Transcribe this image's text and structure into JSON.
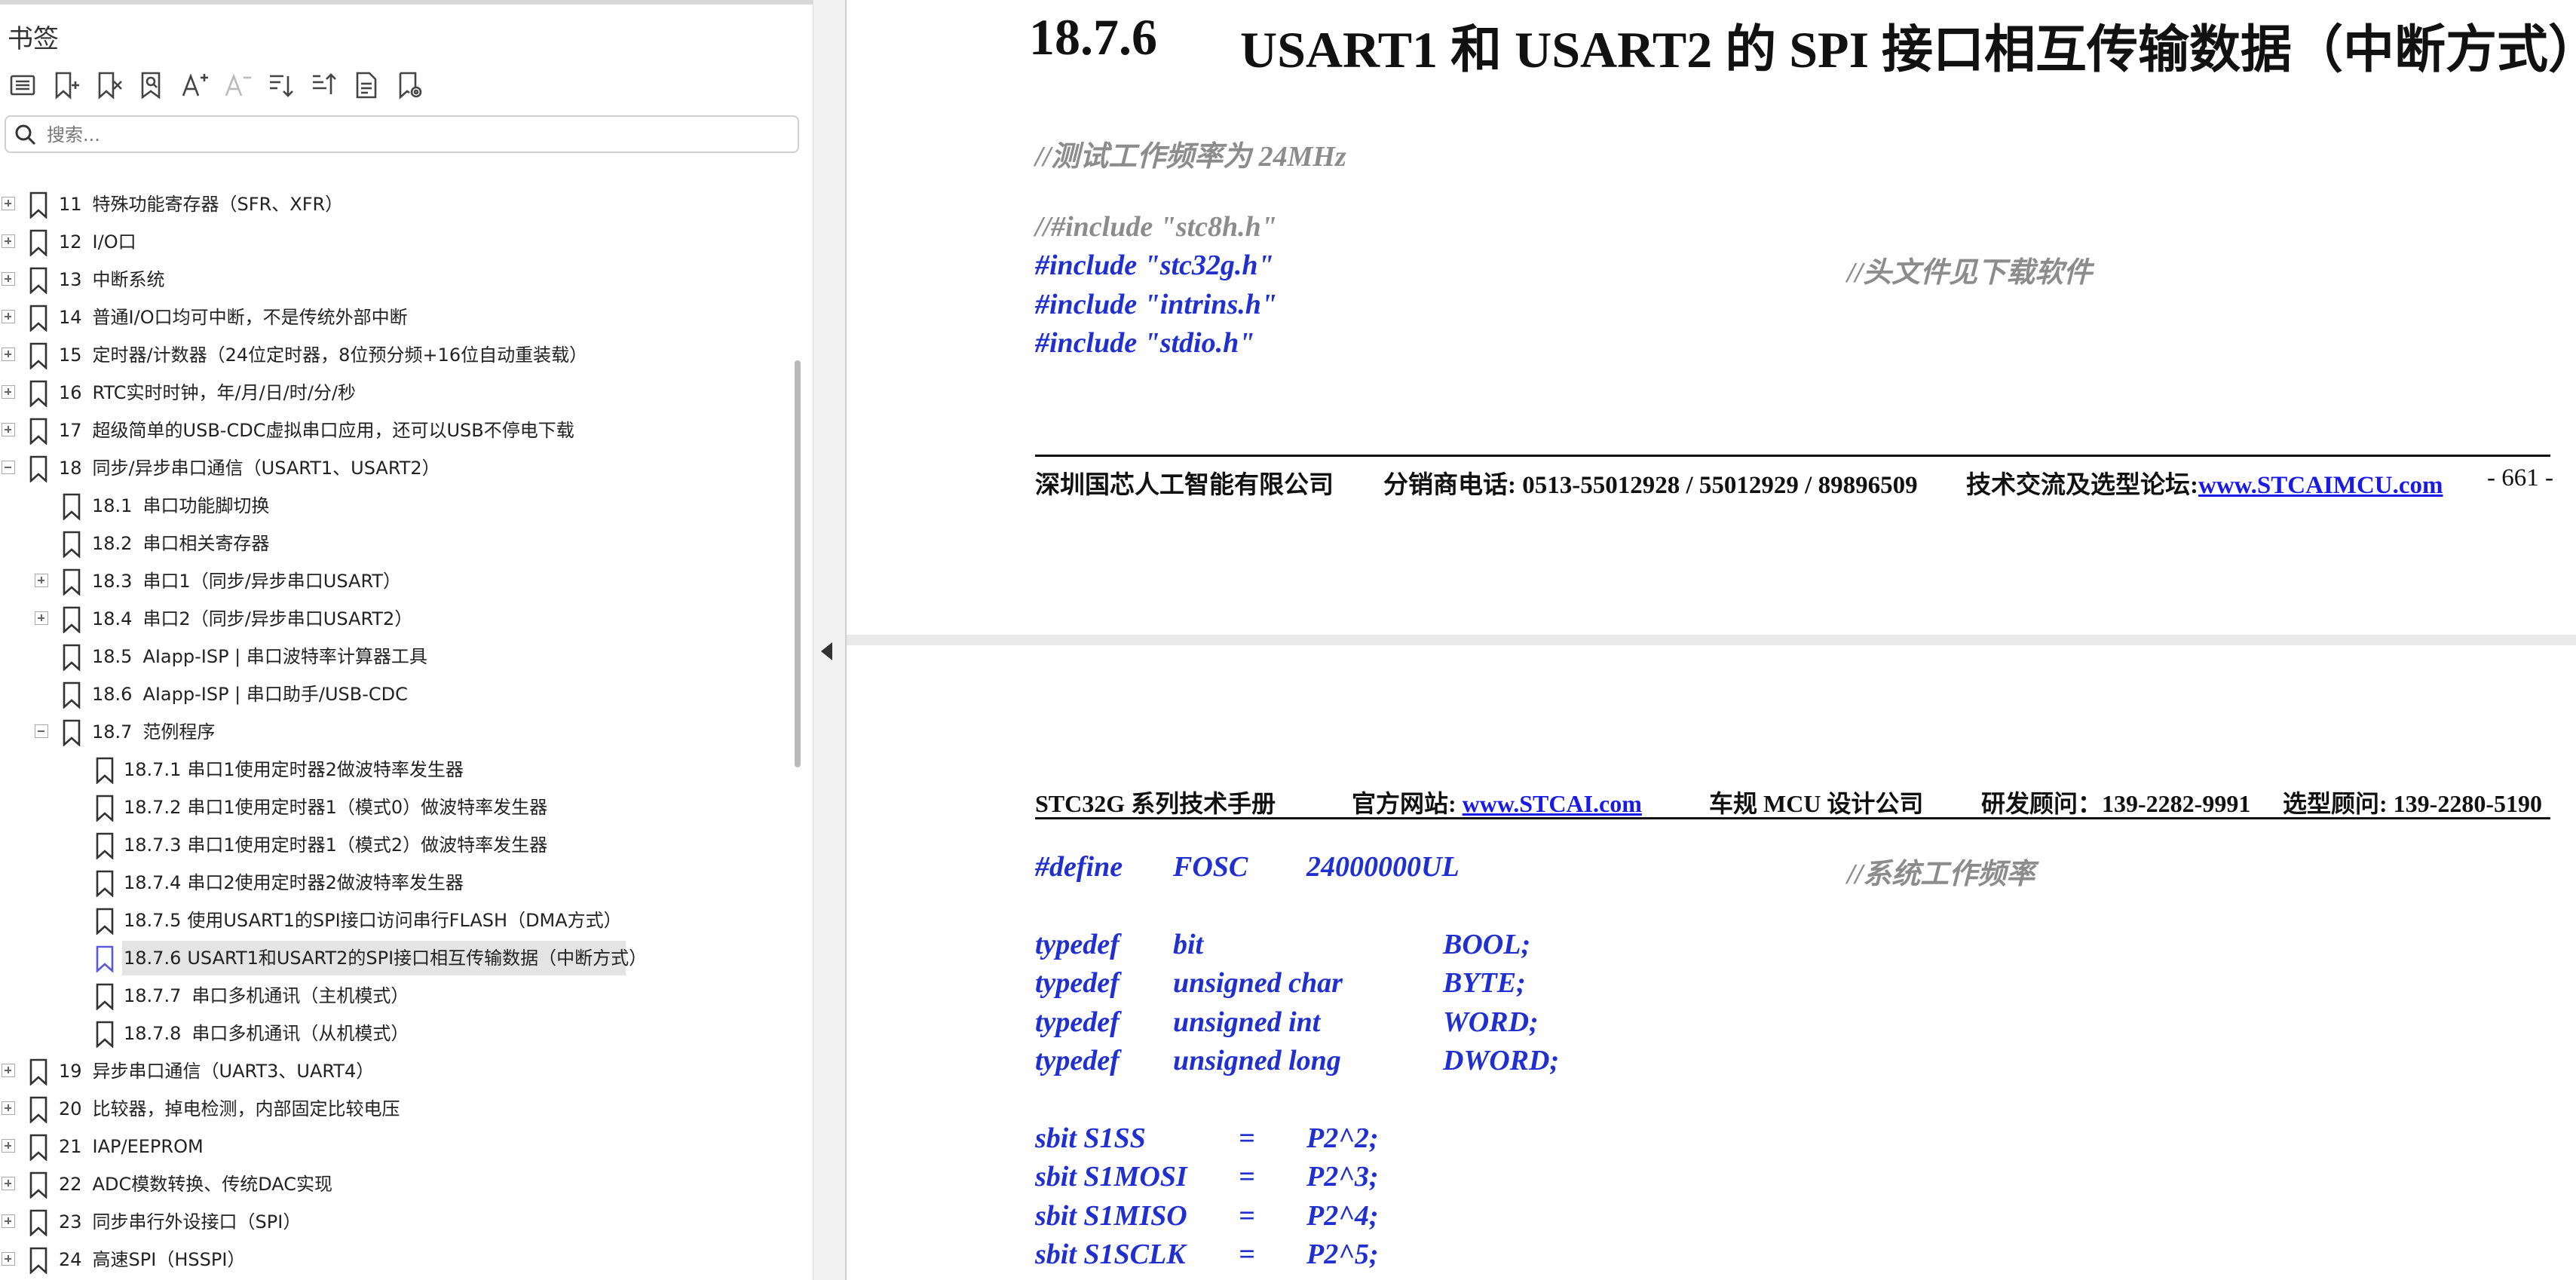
{
  "panel": {
    "title": "书签",
    "search_placeholder": "搜索..."
  },
  "toolbar_icons": [
    "list-icon",
    "add-bookmark-icon",
    "delete-bookmark-icon",
    "find-bookmark-icon",
    "font-increase-icon",
    "font-decrease-icon",
    "expand-all-icon",
    "collapse-all-icon",
    "current-bookmark-icon",
    "bookmark-settings-icon"
  ],
  "bookmarks": [
    {
      "level": 0,
      "exp": "plus",
      "num": "11",
      "text": "特殊功能寄存器（SFR、XFR）"
    },
    {
      "level": 0,
      "exp": "plus",
      "num": "12",
      "text": "I/O口"
    },
    {
      "level": 0,
      "exp": "plus",
      "num": "13",
      "text": "中断系统"
    },
    {
      "level": 0,
      "exp": "plus",
      "num": "14",
      "text": "普通I/O口均可中断，不是传统外部中断"
    },
    {
      "level": 0,
      "exp": "plus",
      "num": "15",
      "text": "定时器/计数器（24位定时器，8位预分频+16位自动重装载）"
    },
    {
      "level": 0,
      "exp": "plus",
      "num": "16",
      "text": "RTC实时时钟，年/月/日/时/分/秒"
    },
    {
      "level": 0,
      "exp": "plus",
      "num": "17",
      "text": "超级简单的USB-CDC虚拟串口应用，还可以USB不停电下载"
    },
    {
      "level": 0,
      "exp": "minus",
      "num": "18",
      "text": "同步/异步串口通信（USART1、USART2）"
    },
    {
      "level": 1,
      "exp": "",
      "num": "18.1",
      "text": "串口功能脚切换"
    },
    {
      "level": 1,
      "exp": "",
      "num": "18.2",
      "text": "串口相关寄存器"
    },
    {
      "level": 1,
      "exp": "plus",
      "num": "18.3",
      "text": "串口1（同步/异步串口USART）"
    },
    {
      "level": 1,
      "exp": "plus",
      "num": "18.4",
      "text": "串口2（同步/异步串口USART2）"
    },
    {
      "level": 1,
      "exp": "",
      "num": "18.5",
      "text": "AIapp-ISP | 串口波特率计算器工具"
    },
    {
      "level": 1,
      "exp": "",
      "num": "18.6",
      "text": "AIapp-ISP | 串口助手/USB-CDC"
    },
    {
      "level": 1,
      "exp": "minus",
      "num": "18.7",
      "text": "范例程序"
    },
    {
      "level": 2,
      "exp": "",
      "num": "18.7.1",
      "text": "串口1使用定时器2做波特率发生器"
    },
    {
      "level": 2,
      "exp": "",
      "num": "18.7.2",
      "text": "串口1使用定时器1（模式0）做波特率发生器"
    },
    {
      "level": 2,
      "exp": "",
      "num": "18.7.3",
      "text": "串口1使用定时器1（模式2）做波特率发生器"
    },
    {
      "level": 2,
      "exp": "",
      "num": "18.7.4",
      "text": "串口2使用定时器2做波特率发生器"
    },
    {
      "level": 2,
      "exp": "",
      "num": "18.7.5",
      "text": "使用USART1的SPI接口访问串行FLASH（DMA方式）"
    },
    {
      "level": 2,
      "exp": "",
      "num": "18.7.6",
      "text": "USART1和USART2的SPI接口相互传输数据（中断方式）",
      "selected": true
    },
    {
      "level": 2,
      "exp": "",
      "num": "18.7.7",
      "text": "串口多机通讯（主机模式）"
    },
    {
      "level": 2,
      "exp": "",
      "num": "18.7.8",
      "text": "串口多机通讯（从机模式）"
    },
    {
      "level": 0,
      "exp": "plus",
      "num": "19",
      "text": "异步串口通信（UART3、UART4）"
    },
    {
      "level": 0,
      "exp": "plus",
      "num": "20",
      "text": "比较器，掉电检测，内部固定比较电压"
    },
    {
      "level": 0,
      "exp": "plus",
      "num": "21",
      "text": "IAP/EEPROM"
    },
    {
      "level": 0,
      "exp": "plus",
      "num": "22",
      "text": "ADC模数转换、传统DAC实现"
    },
    {
      "level": 0,
      "exp": "plus",
      "num": "23",
      "text": "同步串行外设接口（SPI）"
    },
    {
      "level": 0,
      "exp": "plus",
      "num": "24",
      "text": "高速SPI（HSSPI）"
    }
  ],
  "page1": {
    "heading_num": "18.7.6",
    "heading_text": "USART1 和 USART2 的 SPI 接口相互传输数据（中断方式）",
    "comment_freq": "//测试工作频率为 24MHz",
    "inc_stc8h": "//#include \"stc8h.h\"",
    "inc_stc32g": "#include \"stc32g.h\"",
    "inc_comment": "//头文件见下载软件",
    "inc_intrins": "#include \"intrins.h\"",
    "inc_stdio": "#include \"stdio.h\"",
    "footer_company": "深圳国芯人工智能有限公司",
    "footer_phone": "分销商电话: 0513-55012928 / 55012929 / 89896509",
    "footer_forum_label": "技术交流及选型论坛:",
    "footer_forum_link": "www.STCAIMCU.com",
    "footer_page": "- 661 -"
  },
  "page2": {
    "hdr_manual": "STC32G 系列技术手册",
    "hdr_site_label": "官方网站:",
    "hdr_site_link": "www.STCAI.com",
    "hdr_company": "车规 MCU 设计公司",
    "hdr_rd": "研发顾问：139-2282-9991",
    "hdr_sel": "选型顾问: 139-2280-5190",
    "define": [
      "#define",
      "FOSC",
      "24000000UL",
      "//系统工作频率"
    ],
    "typedefs": [
      [
        "typedef",
        "bit",
        "BOOL;"
      ],
      [
        "typedef",
        "unsigned char",
        "BYTE;"
      ],
      [
        "typedef",
        "unsigned int",
        "WORD;"
      ],
      [
        "typedef",
        "unsigned long",
        "DWORD;"
      ]
    ],
    "sbits": [
      [
        "sbit S1SS",
        "=",
        "P2^2;"
      ],
      [
        "sbit S1MOSI",
        "=",
        "P2^3;"
      ],
      [
        "sbit S1MISO",
        "=",
        "P2^4;"
      ],
      [
        "sbit S1SCLK",
        "=",
        "P2^5;"
      ]
    ]
  }
}
